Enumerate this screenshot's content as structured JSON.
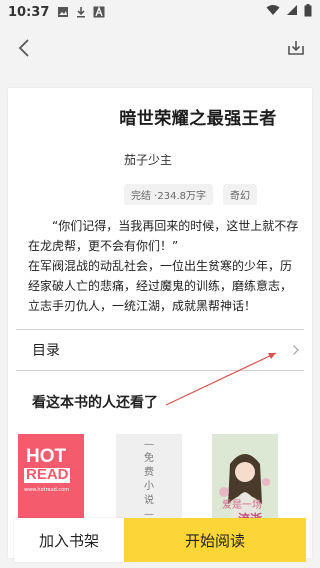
{
  "status_bar": {
    "time": "10:37",
    "left_icons": [
      "image-icon",
      "download-icon",
      "app-a-icon"
    ],
    "right_icons": [
      "wifi-icon",
      "signal-icon",
      "battery-icon"
    ]
  },
  "header": {
    "back_icon": "back-arrow-icon",
    "download_icon": "download-tray-icon"
  },
  "book": {
    "title": "暗世荣耀之最强王者",
    "author": "茄子少主",
    "status_tag": "完结 ·234.8万字",
    "genre_tag": "奇幻",
    "description_lines": [
      "“你们记得，当我再回来的时候，这世上就不存在龙虎帮，更不会有你们！”",
      "在军阀混战的动乱社会，一位出生贫寒的少年，历经家破人亡的悲痛，经过魔鬼的训练，磨练意志，立志手刃仇人，一统江湖，成就黑帮神话！"
    ]
  },
  "toc": {
    "label": "目录",
    "chevron_icon": "chevron-right-icon"
  },
  "recommend": {
    "title": "看这本书的人还看了",
    "covers": [
      {
        "text_line1": "HOT",
        "text_line2": "READ",
        "small": "www.hotread.com"
      },
      {
        "text": "— 免 费 小 说 —"
      },
      {
        "text_line1": "爱是一场",
        "text_line2": "流逝"
      }
    ]
  },
  "actions": {
    "add_shelf": "加入书架",
    "start_reading": "开始阅读"
  },
  "colors": {
    "accent": "#fcd636",
    "annotation_arrow": "#d9534f",
    "hot_cover": "#f45c6e"
  }
}
